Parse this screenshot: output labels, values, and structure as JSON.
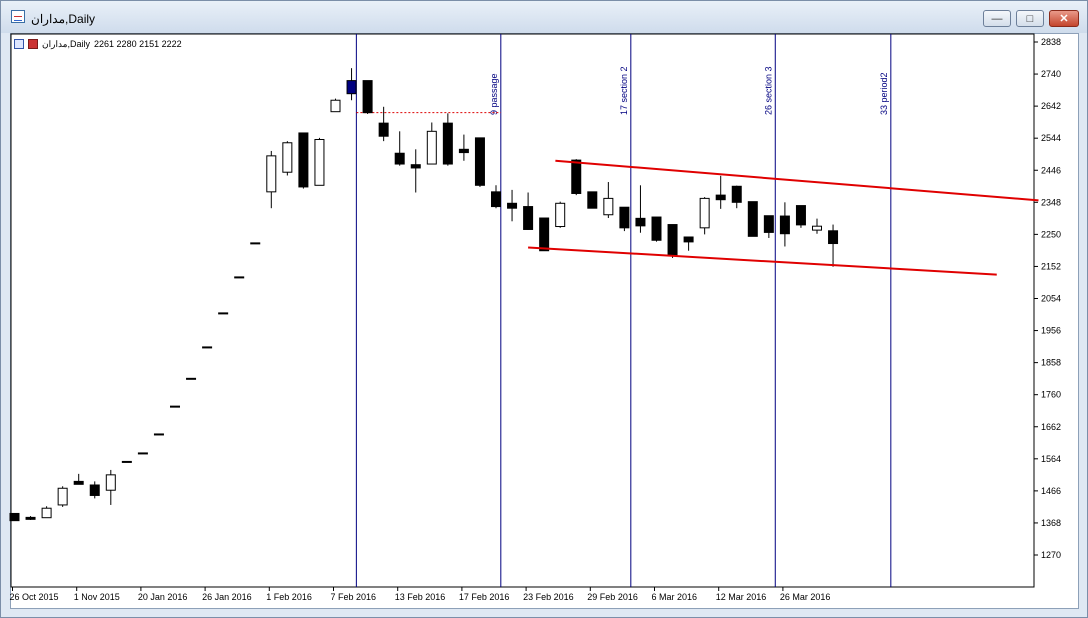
{
  "window": {
    "title": "مداران,Daily",
    "buttons": {
      "minimize": "—",
      "maximize": "□",
      "close": "✕"
    },
    "icon": "chart-window-icon"
  },
  "header": {
    "symbol_period": "مداران,Daily",
    "ohlc": "2261 2280 2151 2222",
    "icons": [
      "symbol-list-icon",
      "indicator-icon"
    ]
  },
  "colors": {
    "background": "#ffffff",
    "bull_fill": "#ffffff",
    "bear_fill": "#000000",
    "channel": "#e00000",
    "vlines": "#000080",
    "last_candle_fill": "#000080"
  },
  "chart_data": {
    "type": "candlestick",
    "price_ticks": [
      2838,
      2740,
      2642,
      2544,
      2446,
      2348,
      2250,
      2152,
      2054,
      1956,
      1858,
      1760,
      1662,
      1564,
      1466,
      1368,
      1270
    ],
    "ylim": [
      1172,
      2860
    ],
    "date_labels": [
      "26 Oct 2015",
      "1 Nov 2015",
      "20 Jan 2016",
      "26 Jan 2016",
      "1 Feb 2016",
      "7 Feb 2016",
      "13 Feb 2016",
      "17 Feb 2016",
      "23 Feb 2016",
      "29 Feb 2016",
      "6 Mar 2016",
      "12 Mar 2016",
      "26 Mar 2016"
    ],
    "date_label_bar_index": [
      0,
      4,
      8,
      12,
      16,
      20,
      24,
      28,
      32,
      36,
      40,
      44,
      48
    ],
    "candles": [
      {
        "o": 1397,
        "h": 1397,
        "l": 1375,
        "c": 1375
      },
      {
        "o": 1385,
        "h": 1389,
        "l": 1377,
        "c": 1379
      },
      {
        "o": 1384,
        "h": 1419,
        "l": 1384,
        "c": 1413
      },
      {
        "o": 1423,
        "h": 1480,
        "l": 1417,
        "c": 1474
      },
      {
        "o": 1495,
        "h": 1518,
        "l": 1491,
        "c": 1486
      },
      {
        "o": 1484,
        "h": 1495,
        "l": 1443,
        "c": 1452
      },
      {
        "o": 1468,
        "h": 1530,
        "l": 1423,
        "c": 1515
      },
      {
        "o": 1556,
        "h": 1556,
        "l": 1556,
        "c": 1556
      },
      {
        "o": 1582,
        "h": 1582,
        "l": 1582,
        "c": 1582
      },
      {
        "o": 1640,
        "h": 1640,
        "l": 1640,
        "c": 1640
      },
      {
        "o": 1725,
        "h": 1725,
        "l": 1725,
        "c": 1725
      },
      {
        "o": 1810,
        "h": 1810,
        "l": 1810,
        "c": 1810
      },
      {
        "o": 1906,
        "h": 1906,
        "l": 1906,
        "c": 1906
      },
      {
        "o": 2010,
        "h": 2010,
        "l": 2010,
        "c": 2010
      },
      {
        "o": 2120,
        "h": 2120,
        "l": 2120,
        "c": 2120
      },
      {
        "o": 2224,
        "h": 2224,
        "l": 2224,
        "c": 2224
      },
      {
        "o": 2380,
        "h": 2505,
        "l": 2330,
        "c": 2490
      },
      {
        "o": 2440,
        "h": 2535,
        "l": 2430,
        "c": 2530
      },
      {
        "o": 2560,
        "h": 2560,
        "l": 2390,
        "c": 2395
      },
      {
        "o": 2400,
        "h": 2545,
        "l": 2400,
        "c": 2540
      },
      {
        "o": 2625,
        "h": 2665,
        "l": 2625,
        "c": 2660
      },
      {
        "o": 2720,
        "h": 2758,
        "l": 2660,
        "c": 2680
      },
      {
        "o": 2720,
        "h": 2720,
        "l": 2618,
        "c": 2622
      },
      {
        "o": 2590,
        "h": 2640,
        "l": 2535,
        "c": 2550
      },
      {
        "o": 2498,
        "h": 2565,
        "l": 2460,
        "c": 2465
      },
      {
        "o": 2463,
        "h": 2510,
        "l": 2378,
        "c": 2453
      },
      {
        "o": 2465,
        "h": 2592,
        "l": 2465,
        "c": 2565
      },
      {
        "o": 2590,
        "h": 2620,
        "l": 2460,
        "c": 2465
      },
      {
        "o": 2510,
        "h": 2555,
        "l": 2475,
        "c": 2500
      },
      {
        "o": 2545,
        "h": 2545,
        "l": 2395,
        "c": 2400
      },
      {
        "o": 2380,
        "h": 2400,
        "l": 2330,
        "c": 2335
      },
      {
        "o": 2345,
        "h": 2386,
        "l": 2290,
        "c": 2330
      },
      {
        "o": 2335,
        "h": 2378,
        "l": 2264,
        "c": 2265
      },
      {
        "o": 2300,
        "h": 2300,
        "l": 2200,
        "c": 2200
      },
      {
        "o": 2274,
        "h": 2350,
        "l": 2270,
        "c": 2345
      },
      {
        "o": 2477,
        "h": 2480,
        "l": 2370,
        "c": 2375
      },
      {
        "o": 2380,
        "h": 2380,
        "l": 2330,
        "c": 2330
      },
      {
        "o": 2310,
        "h": 2410,
        "l": 2300,
        "c": 2360
      },
      {
        "o": 2333,
        "h": 2333,
        "l": 2260,
        "c": 2270
      },
      {
        "o": 2299,
        "h": 2400,
        "l": 2255,
        "c": 2276
      },
      {
        "o": 2303,
        "h": 2303,
        "l": 2228,
        "c": 2232
      },
      {
        "o": 2280,
        "h": 2280,
        "l": 2178,
        "c": 2187
      },
      {
        "o": 2242,
        "h": 2242,
        "l": 2200,
        "c": 2227
      },
      {
        "o": 2270,
        "h": 2364,
        "l": 2250,
        "c": 2360
      },
      {
        "o": 2370,
        "h": 2429,
        "l": 2328,
        "c": 2356
      },
      {
        "o": 2397,
        "h": 2399,
        "l": 2330,
        "c": 2348
      },
      {
        "o": 2350,
        "h": 2350,
        "l": 2244,
        "c": 2244
      },
      {
        "o": 2307,
        "h": 2307,
        "l": 2239,
        "c": 2256
      },
      {
        "o": 2306,
        "h": 2348,
        "l": 2213,
        "c": 2252
      },
      {
        "o": 2338,
        "h": 2338,
        "l": 2270,
        "c": 2279
      },
      {
        "o": 2263,
        "h": 2298,
        "l": 2252,
        "c": 2275
      },
      {
        "o": 2261,
        "h": 2280,
        "l": 2151,
        "c": 2222
      }
    ],
    "vertical_lines": [
      {
        "bar": 21.3,
        "label": ""
      },
      {
        "bar": 30.3,
        "label": "9 passage"
      },
      {
        "bar": 38.4,
        "label": "17 section 2"
      },
      {
        "bar": 47.4,
        "label": "26 section 3"
      },
      {
        "bar": 54.6,
        "label": "33 period2"
      }
    ],
    "channel_lines": [
      {
        "from": {
          "bar": 33.7,
          "price": 2475
        },
        "to": {
          "bar": 63.8,
          "price": 2354
        }
      },
      {
        "from": {
          "bar": 32.0,
          "price": 2210
        },
        "to": {
          "bar": 61.2,
          "price": 2127
        }
      }
    ],
    "dotted_level": {
      "price": 2622,
      "from_bar": 21.3,
      "to_bar": 30.3
    }
  }
}
